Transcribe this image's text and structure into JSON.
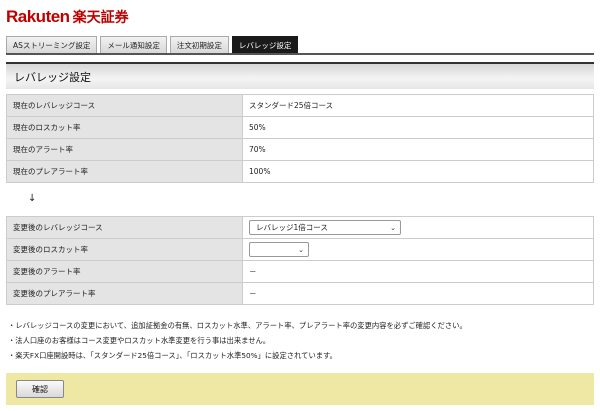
{
  "brand": {
    "name_en": "Rakuten",
    "name_jp": "楽天証券"
  },
  "tabs": [
    {
      "label": "ASストリーミング設定",
      "active": false
    },
    {
      "label": "メール通知設定",
      "active": false
    },
    {
      "label": "注文初期設定",
      "active": false
    },
    {
      "label": "レバレッジ設定",
      "active": true
    }
  ],
  "page": {
    "title": "レバレッジ設定"
  },
  "current": [
    {
      "label": "現在のレバレッジコース",
      "value": "スタンダード25倍コース"
    },
    {
      "label": "現在のロスカット率",
      "value": "50%"
    },
    {
      "label": "現在のアラート率",
      "value": "70%"
    },
    {
      "label": "現在のプレアラート率",
      "value": "100%"
    }
  ],
  "arrow": "↓",
  "after": {
    "leverage": {
      "label": "変更後のレバレッジコース",
      "selected": "レバレッジ1倍コース"
    },
    "losscut": {
      "label": "変更後のロスカット率",
      "selected": ""
    },
    "alert": {
      "label": "変更後のアラート率",
      "value": "－"
    },
    "prealert": {
      "label": "変更後のプレアラート率",
      "value": "－"
    }
  },
  "notes": [
    "・レバレッジコースの変更において、追加証拠金の有無、ロスカット水準、アラート率、プレアラート率の変更内容を必ずご確認ください。",
    "・法人口座のお客様はコース変更やロスカット水準変更を行う事は出来ません。",
    "・楽天FX口座開設時は、「スタンダード25倍コース」、「ロスカット水準50%」に設定されています。"
  ],
  "confirm_button": "確認",
  "colors": {
    "brand": "#bf0000",
    "footer": "#efe7a4",
    "label_bg": "#e4e4e4"
  }
}
